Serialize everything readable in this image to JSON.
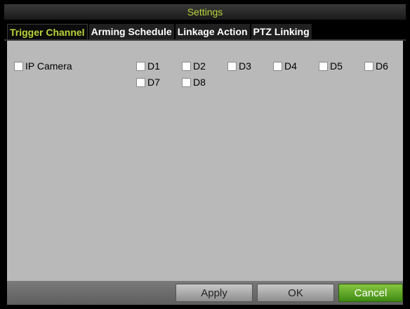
{
  "window": {
    "title": "Settings"
  },
  "tabs": [
    {
      "label": "Trigger Channel",
      "active": true
    },
    {
      "label": "Arming Schedule",
      "active": false
    },
    {
      "label": "Linkage Action",
      "active": false
    },
    {
      "label": "PTZ Linking",
      "active": false
    }
  ],
  "trigger": {
    "ip_camera_label": "IP Camera",
    "channels": [
      "D1",
      "D2",
      "D3",
      "D4",
      "D5",
      "D6",
      "D7",
      "D8"
    ],
    "checked": []
  },
  "footer": {
    "apply_label": "Apply",
    "ok_label": "OK",
    "cancel_label": "Cancel"
  },
  "colors": {
    "accent": "#b8d43a",
    "panel": "#b9b9b9",
    "cancel": "#5ea82a"
  }
}
